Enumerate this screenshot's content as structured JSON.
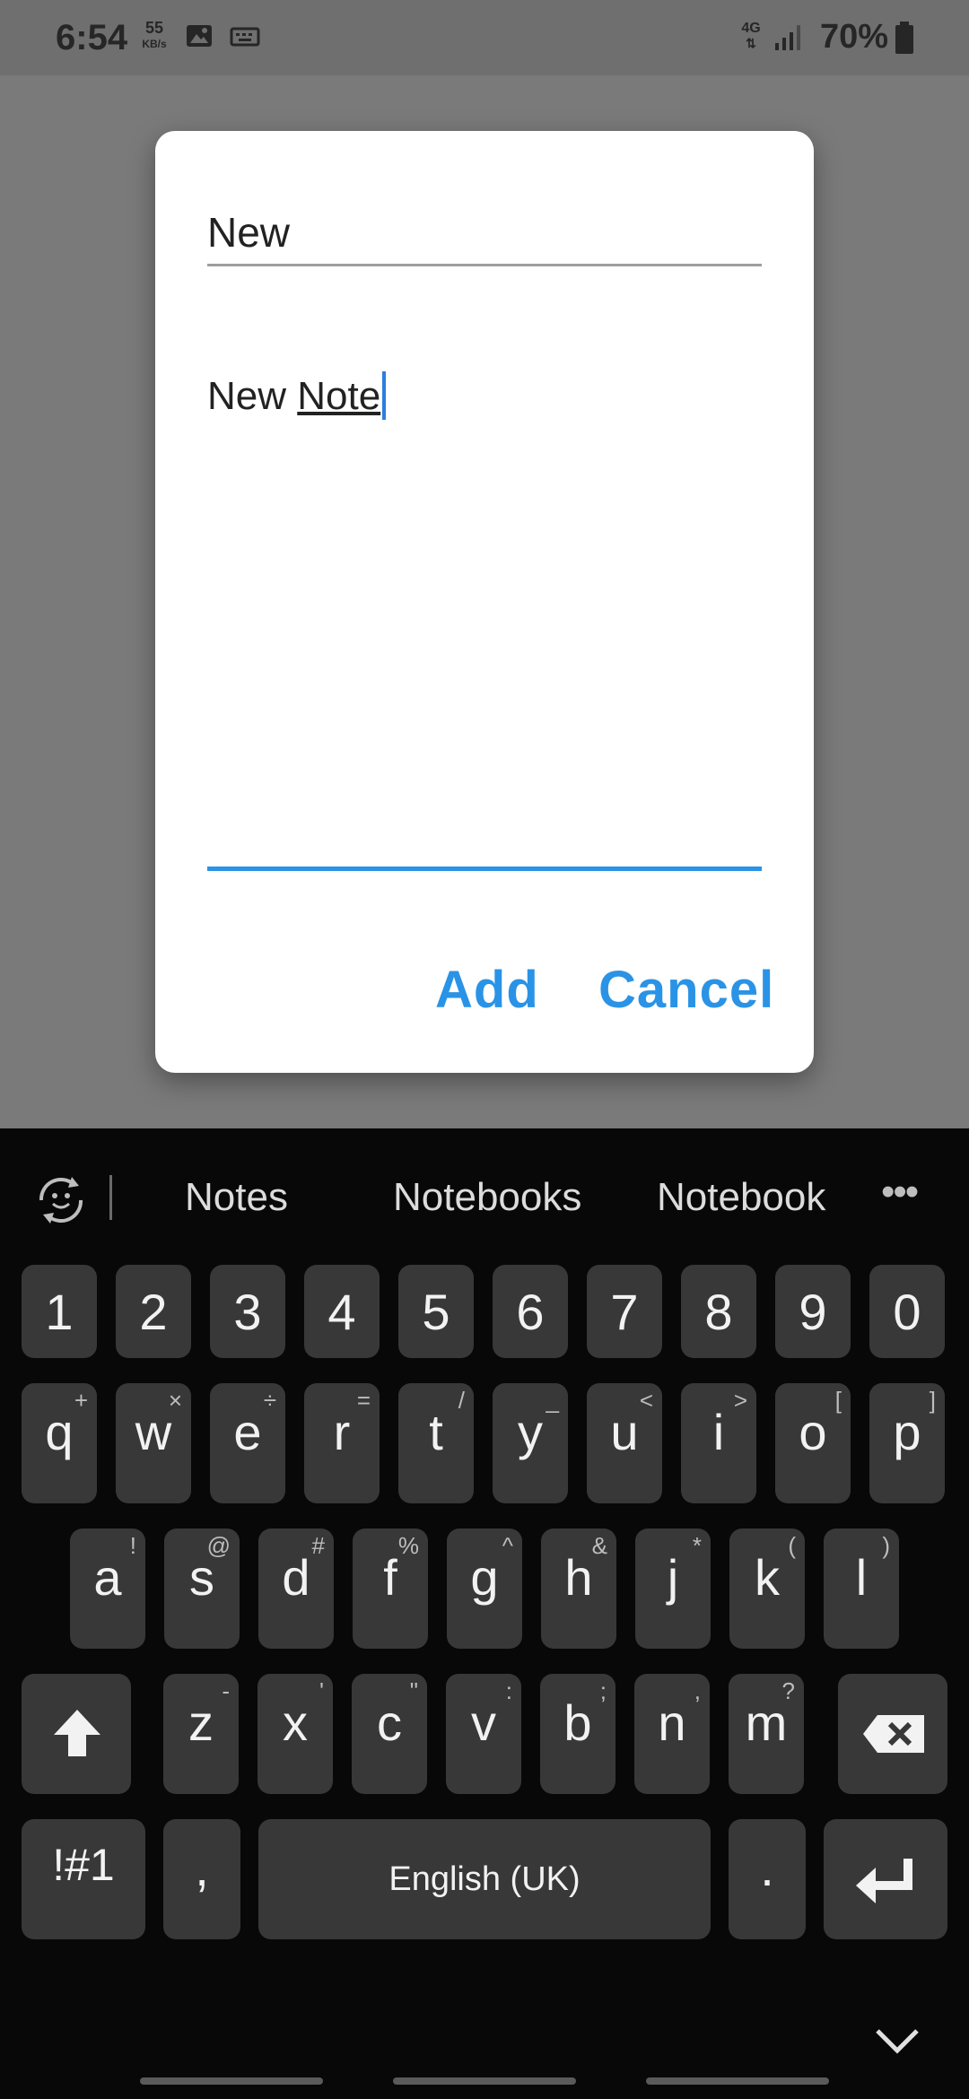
{
  "status_bar": {
    "time": "6:54",
    "speed": "55",
    "speed_unit": "KB/s",
    "network": "4G",
    "battery_pct": "70%"
  },
  "dialog": {
    "title_value": "New",
    "body_value_plain": "New ",
    "body_value_underlined": "Note",
    "add_label": "Add",
    "cancel_label": "Cancel",
    "accent_color": "#2a93e6"
  },
  "keyboard": {
    "suggestions": [
      "Notes",
      "Notebooks",
      "Notebook"
    ],
    "number_row": [
      "1",
      "2",
      "3",
      "4",
      "5",
      "6",
      "7",
      "8",
      "9",
      "0"
    ],
    "row1": [
      {
        "k": "q",
        "s": "+"
      },
      {
        "k": "w",
        "s": "×"
      },
      {
        "k": "e",
        "s": "÷"
      },
      {
        "k": "r",
        "s": "="
      },
      {
        "k": "t",
        "s": "/"
      },
      {
        "k": "y",
        "s": "_"
      },
      {
        "k": "u",
        "s": "<"
      },
      {
        "k": "i",
        "s": ">"
      },
      {
        "k": "o",
        "s": "["
      },
      {
        "k": "p",
        "s": "]"
      }
    ],
    "row2": [
      {
        "k": "a",
        "s": "!"
      },
      {
        "k": "s",
        "s": "@"
      },
      {
        "k": "d",
        "s": "#"
      },
      {
        "k": "f",
        "s": "%"
      },
      {
        "k": "g",
        "s": "^"
      },
      {
        "k": "h",
        "s": "&"
      },
      {
        "k": "j",
        "s": "*"
      },
      {
        "k": "k",
        "s": "("
      },
      {
        "k": "l",
        "s": ")"
      }
    ],
    "row3": [
      {
        "k": "z",
        "s": "-"
      },
      {
        "k": "x",
        "s": "'"
      },
      {
        "k": "c",
        "s": "\""
      },
      {
        "k": "v",
        "s": ":"
      },
      {
        "k": "b",
        "s": ";"
      },
      {
        "k": "n",
        "s": ","
      },
      {
        "k": "m",
        "s": "?"
      }
    ],
    "symbols_label": "!#1",
    "comma_label": ",",
    "space_label": "English (UK)",
    "period_label": "."
  }
}
